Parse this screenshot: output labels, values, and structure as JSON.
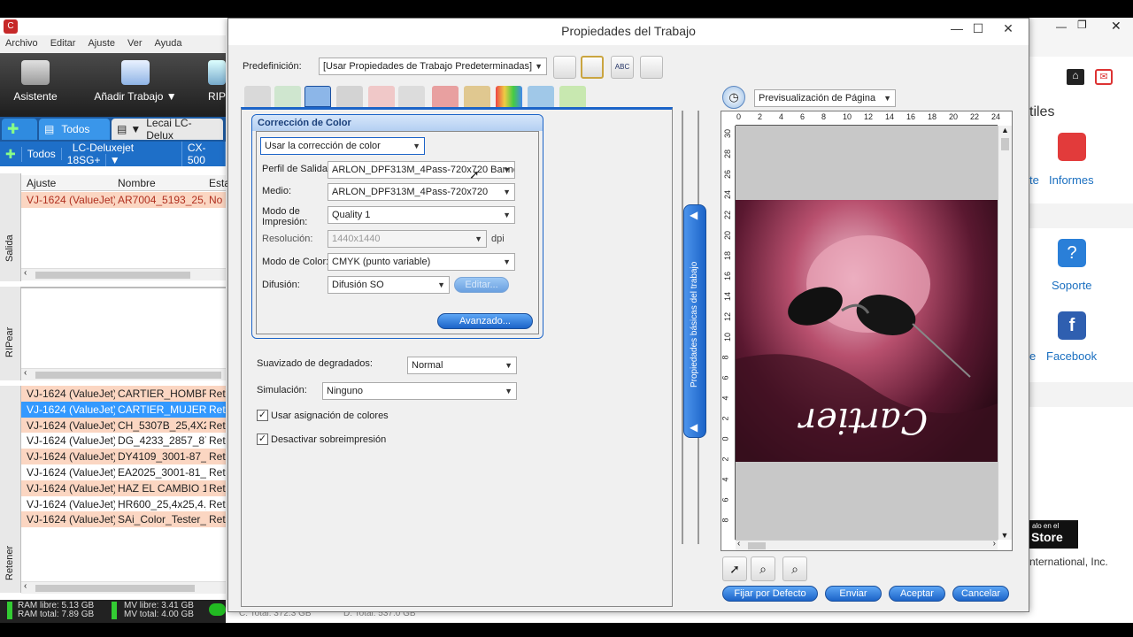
{
  "app": {
    "menu": [
      "Archivo",
      "Editar",
      "Ajuste",
      "Ver",
      "Ayuda"
    ],
    "ribbon": {
      "wizard": "Asistente",
      "add_job": "Añadir Trabajo",
      "rip": "RIP"
    },
    "tabs": {
      "all": "Todos",
      "printer": "Lecai LC-Delux"
    },
    "printer_bar": {
      "all": "Todos",
      "printer1": "LC-Deluxejet 18SG+",
      "printer2": "CX-500"
    },
    "side_labels": {
      "output": "Salida",
      "rip": "RIPear",
      "hold": "Retener"
    },
    "columns": {
      "setup": "Ajuste",
      "name": "Nombre",
      "status": "Esta"
    },
    "output_rows": [
      {
        "setup": "VJ-1624 (ValueJet)",
        "name": "AR7004_5193_25,4x2",
        "status": "No"
      }
    ],
    "hold_rows": [
      {
        "setup": "VJ-1624 (ValueJet)",
        "name": "CARTIER_HOMBRE_",
        "status": "Ret"
      },
      {
        "setup": "VJ-1624 (ValueJet)",
        "name": "CARTIER_MUJER_10",
        "status": "Ret"
      },
      {
        "setup": "VJ-1624 (ValueJet)",
        "name": "CH_5307B_25,4X25,4",
        "status": "Ret"
      },
      {
        "setup": "VJ-1624 (ValueJet)",
        "name": "DG_4233_2857_87_2!",
        "status": "Ret"
      },
      {
        "setup": "VJ-1624 (ValueJet)",
        "name": "DY4109_3001-87_25,",
        "status": "Ret"
      },
      {
        "setup": "VJ-1624 (ValueJet)",
        "name": "EA2025_3001-81_25,",
        "status": "Ret"
      },
      {
        "setup": "VJ-1624 (ValueJet)",
        "name": "HAZ EL CAMBIO 15,",
        "status": "Ret"
      },
      {
        "setup": "VJ-1624 (ValueJet)",
        "name": "HR600_25,4x25,4.jpg",
        "status": "Ret"
      },
      {
        "setup": "VJ-1624 (ValueJet)",
        "name": "SAi_Color_Tester_20",
        "status": "Ret"
      }
    ],
    "status": {
      "ram_free": "RAM libre: 5.13 GB",
      "ram_total": "RAM total: 7.89 GB",
      "mv_free": "MV libre: 3.41 GB",
      "mv_total": "MV total: 4.00 GB",
      "c_total": "C: Total: 372.3 GB",
      "d_total": "D: Total: 537.0 GB"
    }
  },
  "bg_app": {
    "heading": "tiles",
    "items": {
      "reports": "Informes",
      "reports_cut": "te",
      "support": "Soporte",
      "facebook": "Facebook",
      "facebook_cut": "e"
    },
    "store_small": "alo en el",
    "store": "Store",
    "footer": "nternational, Inc."
  },
  "dialog": {
    "title": "Propiedades del Trabajo",
    "preset_label": "Predefinición:",
    "preset_value": "[Usar Propiedades de Trabajo Predeterminadas]",
    "icon_abc": "ABC",
    "group_title": "Corrección de Color",
    "use_cc": "Usar la corrección de color",
    "fields": {
      "output_profile": {
        "label": "Perfil de Salida:",
        "value": "ARLON_DPF313M_4Pass-720x720 Banner"
      },
      "media": {
        "label": "Medio:",
        "value": "ARLON_DPF313M_4Pass-720x720"
      },
      "print_mode": {
        "label": "Modo de Impresión:",
        "value": "Quality 1"
      },
      "resolution": {
        "label": "Resolución:",
        "value": "1440x1440",
        "unit": "dpi"
      },
      "color_mode": {
        "label": "Modo de Color:",
        "value": "CMYK (punto variable)"
      },
      "diffusion": {
        "label": "Difusión:",
        "value": "Difusión SO",
        "edit": "Editar..."
      }
    },
    "advanced": "Avanzado...",
    "smoothing": {
      "label": "Suavizado de degradados:",
      "value": "Normal"
    },
    "simulation": {
      "label": "Simulación:",
      "value": "Ninguno"
    },
    "checks": {
      "use_color_mapping": "Usar asignación de colores",
      "disable_overprint": "Desactivar sobreimpresión"
    },
    "side_tab": "Propiedades básicas del trabajo",
    "preview_mode": "Previsualización de Página",
    "ruler_top": [
      "0",
      "2",
      "4",
      "6",
      "8",
      "10",
      "12",
      "14",
      "16",
      "18",
      "20",
      "22",
      "24"
    ],
    "ruler_left": [
      "30",
      "28",
      "26",
      "24",
      "22",
      "20",
      "18",
      "16",
      "14",
      "12",
      "10",
      "8",
      "6",
      "4",
      "2",
      "0",
      "2",
      "4",
      "6",
      "8"
    ],
    "brand": "Cartier",
    "buttons": {
      "set_default": "Fijar por Defecto",
      "send": "Enviar",
      "accept": "Aceptar",
      "cancel": "Cancelar"
    }
  }
}
